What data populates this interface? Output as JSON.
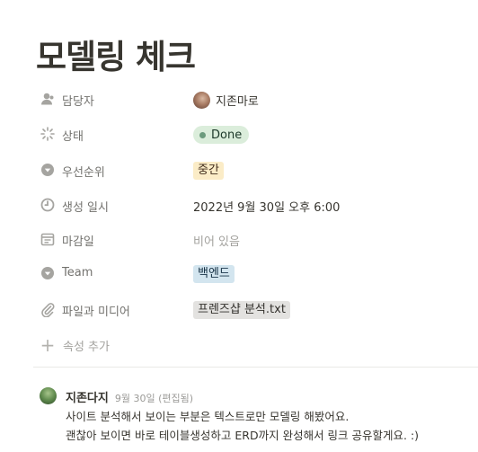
{
  "page": {
    "title": "모델링 체크"
  },
  "properties": [
    {
      "name": "담당자",
      "icon": "person-icon",
      "type": "person",
      "value": "지존마로"
    },
    {
      "name": "상태",
      "icon": "status-icon",
      "type": "status",
      "value": "Done",
      "color": "#dbeddb"
    },
    {
      "name": "우선순위",
      "icon": "select-icon",
      "type": "select",
      "value": "중간",
      "color": "#fbecc7"
    },
    {
      "name": "생성 일시",
      "icon": "clock-icon",
      "type": "date",
      "value": "2022년 9월 30일 오후 6:00"
    },
    {
      "name": "마감일",
      "icon": "calendar-icon",
      "type": "empty",
      "value": "비어 있음"
    },
    {
      "name": "Team",
      "icon": "select-icon",
      "type": "select",
      "value": "백엔드",
      "color": "#d3e5ef"
    },
    {
      "name": "파일과 미디어",
      "icon": "paperclip-icon",
      "type": "file",
      "value": "프렌즈샵 분석.txt",
      "color": "#e3e2e0"
    }
  ],
  "add_property": {
    "label": "속성 추가",
    "icon": "plus-icon"
  },
  "comment": {
    "author": "지존다지",
    "time": "9월 30일 (편집됨)",
    "lines": [
      "사이트 분석해서 보이는 부분은 텍스트로만 모델링 해봤어요.",
      "괜찮아 보이면 바로 테이블생성하고 ERD까지 완성해서 링크 공유할게요. :)"
    ]
  }
}
